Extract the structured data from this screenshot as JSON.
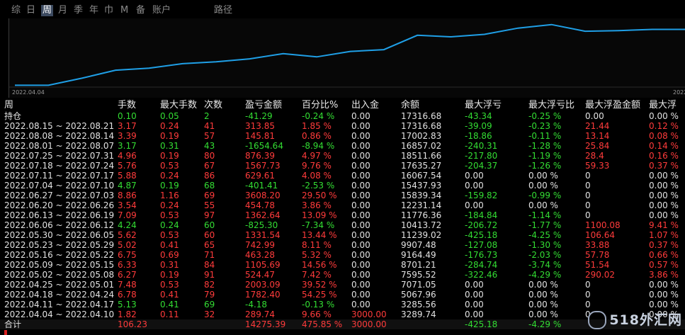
{
  "tabs": [
    "综",
    "日",
    "周",
    "月",
    "季",
    "年",
    "巾",
    "M",
    "备",
    "账户",
    "路径"
  ],
  "active_tab": 2,
  "chart": {
    "start_label": "2022.04.04",
    "end_label": "2022",
    "line_color": "#1f9fe6",
    "balances": [
      3289.74,
      3285.56,
      5067.96,
      7071.05,
      7595.52,
      8701.21,
      9164.49,
      9907.48,
      11239.02,
      10413.72,
      11776.36,
      12231.14,
      15839.34,
      15437.93,
      16067.54,
      17635.27,
      18511.66,
      16857.02,
      17002.83,
      17316.68,
      17316.68
    ]
  },
  "columns": [
    "周",
    "手数",
    "最大手数",
    "次数",
    "盈亏金额",
    "百分比%",
    "出入金",
    "余额",
    "最大浮亏",
    "最大浮亏比",
    "最大浮盈金额",
    "最大浮"
  ],
  "rows": [
    {
      "period": "持仓",
      "lots": "0.10",
      "maxlots": "0.05",
      "count": "2",
      "pnl": "-41.29",
      "pct": "-0.24 %",
      "flow": "0.00",
      "balance": "17316.68",
      "maxdd": "-43.34",
      "maxddpct": "-0.25 %",
      "maxfp": "0.00",
      "maxfppct": "0.00 %",
      "color": "green"
    },
    {
      "period": "2022.08.15 ~ 2022.08.21",
      "lots": "3.17",
      "maxlots": "0.24",
      "count": "41",
      "pnl": "313.85",
      "pct": "1.85 %",
      "flow": "0.00",
      "balance": "17316.68",
      "maxdd": "-39.09",
      "maxddpct": "-0.23 %",
      "maxfp": "21.44",
      "maxfppct": "0.12 %",
      "color": "red"
    },
    {
      "period": "2022.08.08 ~ 2022.08.14",
      "lots": "3.39",
      "maxlots": "0.19",
      "count": "57",
      "pnl": "145.81",
      "pct": "0.86 %",
      "flow": "0.00",
      "balance": "17002.83",
      "maxdd": "-18.86",
      "maxddpct": "-0.11 %",
      "maxfp": "13.14",
      "maxfppct": "0.08 %",
      "color": "red"
    },
    {
      "period": "2022.08.01 ~ 2022.08.07",
      "lots": "3.17",
      "maxlots": "0.31",
      "count": "43",
      "pnl": "-1654.64",
      "pct": "-8.94 %",
      "flow": "0.00",
      "balance": "16857.02",
      "maxdd": "-240.31",
      "maxddpct": "-1.28 %",
      "maxfp": "25.84",
      "maxfppct": "0.14 %",
      "color": "green"
    },
    {
      "period": "2022.07.25 ~ 2022.07.31",
      "lots": "4.96",
      "maxlots": "0.19",
      "count": "80",
      "pnl": "876.39",
      "pct": "4.97 %",
      "flow": "0.00",
      "balance": "18511.66",
      "maxdd": "-217.80",
      "maxddpct": "-1.19 %",
      "maxfp": "28.4",
      "maxfppct": "0.16 %",
      "color": "red"
    },
    {
      "period": "2022.07.18 ~ 2022.07.24",
      "lots": "5.76",
      "maxlots": "0.53",
      "count": "67",
      "pnl": "1567.73",
      "pct": "9.76 %",
      "flow": "0.00",
      "balance": "17635.27",
      "maxdd": "-204.37",
      "maxddpct": "-1.26 %",
      "maxfp": "59.33",
      "maxfppct": "0.37 %",
      "color": "red"
    },
    {
      "period": "2022.07.11 ~ 2022.07.17",
      "lots": "5.88",
      "maxlots": "0.24",
      "count": "86",
      "pnl": "629.61",
      "pct": "4.08 %",
      "flow": "0.00",
      "balance": "16067.54",
      "maxdd": "0.00",
      "maxddpct": "0.00 %",
      "maxfp": "0",
      "maxfppct": "0.00 %",
      "color": "red"
    },
    {
      "period": "2022.07.04 ~ 2022.07.10",
      "lots": "4.87",
      "maxlots": "0.19",
      "count": "68",
      "pnl": "-401.41",
      "pct": "-2.53 %",
      "flow": "0.00",
      "balance": "15437.93",
      "maxdd": "0.00",
      "maxddpct": "0.00 %",
      "maxfp": "0",
      "maxfppct": "0.00 %",
      "color": "green"
    },
    {
      "period": "2022.06.27 ~ 2022.07.03",
      "lots": "8.86",
      "maxlots": "1.16",
      "count": "69",
      "pnl": "3608.20",
      "pct": "29.50 %",
      "flow": "0.00",
      "balance": "15839.34",
      "maxdd": "-159.82",
      "maxddpct": "-0.99 %",
      "maxfp": "0",
      "maxfppct": "0.00 %",
      "color": "red"
    },
    {
      "period": "2022.06.20 ~ 2022.06.26",
      "lots": "3.54",
      "maxlots": "0.24",
      "count": "55",
      "pnl": "454.78",
      "pct": "3.86 %",
      "flow": "0.00",
      "balance": "12231.14",
      "maxdd": "0.00",
      "maxddpct": "0.00 %",
      "maxfp": "0",
      "maxfppct": "0.00 %",
      "color": "red"
    },
    {
      "period": "2022.06.13 ~ 2022.06.19",
      "lots": "7.09",
      "maxlots": "0.53",
      "count": "97",
      "pnl": "1362.64",
      "pct": "13.09 %",
      "flow": "0.00",
      "balance": "11776.36",
      "maxdd": "-184.84",
      "maxddpct": "-1.14 %",
      "maxfp": "0",
      "maxfppct": "0.00 %",
      "color": "red"
    },
    {
      "period": "2022.06.06 ~ 2022.06.12",
      "lots": "4.24",
      "maxlots": "0.24",
      "count": "60",
      "pnl": "-825.30",
      "pct": "-7.34 %",
      "flow": "0.00",
      "balance": "10413.72",
      "maxdd": "-206.72",
      "maxddpct": "-1.77 %",
      "maxfp": "1100.08",
      "maxfppct": "9.41 %",
      "color": "green"
    },
    {
      "period": "2022.05.30 ~ 2022.06.05",
      "lots": "5.62",
      "maxlots": "0.53",
      "count": "60",
      "pnl": "1331.54",
      "pct": "13.44 %",
      "flow": "0.00",
      "balance": "11239.02",
      "maxdd": "-425.18",
      "maxddpct": "-4.25 %",
      "maxfp": "106.64",
      "maxfppct": "1.07 %",
      "color": "red"
    },
    {
      "period": "2022.05.23 ~ 2022.05.29",
      "lots": "5.02",
      "maxlots": "0.41",
      "count": "65",
      "pnl": "742.99",
      "pct": "8.11 %",
      "flow": "0.00",
      "balance": "9907.48",
      "maxdd": "-127.08",
      "maxddpct": "-1.30 %",
      "maxfp": "33.88",
      "maxfppct": "0.37 %",
      "color": "red"
    },
    {
      "period": "2022.05.16 ~ 2022.05.22",
      "lots": "6.75",
      "maxlots": "0.69",
      "count": "71",
      "pnl": "463.28",
      "pct": "5.32 %",
      "flow": "0.00",
      "balance": "9164.49",
      "maxdd": "-176.73",
      "maxddpct": "-2.03 %",
      "maxfp": "57.78",
      "maxfppct": "0.66 %",
      "color": "red"
    },
    {
      "period": "2022.05.09 ~ 2022.05.15",
      "lots": "6.33",
      "maxlots": "0.31",
      "count": "84",
      "pnl": "1105.69",
      "pct": "14.56 %",
      "flow": "0.00",
      "balance": "8701.21",
      "maxdd": "-284.74",
      "maxddpct": "-3.74 %",
      "maxfp": "51.54",
      "maxfppct": "0.57 %",
      "color": "red"
    },
    {
      "period": "2022.05.02 ~ 2022.05.08",
      "lots": "6.27",
      "maxlots": "0.19",
      "count": "91",
      "pnl": "524.47",
      "pct": "7.42 %",
      "flow": "0.00",
      "balance": "7595.52",
      "maxdd": "-322.46",
      "maxddpct": "-4.29 %",
      "maxfp": "290.02",
      "maxfppct": "3.86 %",
      "color": "red"
    },
    {
      "period": "2022.04.25 ~ 2022.05.01",
      "lots": "7.48",
      "maxlots": "0.53",
      "count": "82",
      "pnl": "2003.09",
      "pct": "39.52 %",
      "flow": "0.00",
      "balance": "7071.05",
      "maxdd": "0.00",
      "maxddpct": "0.00 %",
      "maxfp": "0",
      "maxfppct": "0.00 %",
      "color": "red"
    },
    {
      "period": "2022.04.18 ~ 2022.04.24",
      "lots": "6.78",
      "maxlots": "0.41",
      "count": "79",
      "pnl": "1782.40",
      "pct": "54.25 %",
      "flow": "0.00",
      "balance": "5067.96",
      "maxdd": "0.00",
      "maxddpct": "0.00 %",
      "maxfp": "0",
      "maxfppct": "0.00 %",
      "color": "red"
    },
    {
      "period": "2022.04.11 ~ 2022.04.17",
      "lots": "5.13",
      "maxlots": "0.41",
      "count": "69",
      "pnl": "-4.18",
      "pct": "-0.13 %",
      "flow": "0.00",
      "balance": "3285.56",
      "maxdd": "0.00",
      "maxddpct": "0.00 %",
      "maxfp": "0",
      "maxfppct": "0.00 %",
      "color": "green"
    },
    {
      "period": "2022.04.04 ~ 2022.04.10",
      "lots": "1.82",
      "maxlots": "0.11",
      "count": "32",
      "pnl": "289.74",
      "pct": "9.66 %",
      "flow": "3000.00",
      "balance": "3289.74",
      "maxdd": "0.00",
      "maxddpct": "0.00 %",
      "maxfp": "0",
      "maxfppct": "0.00 %",
      "color": "red"
    }
  ],
  "total": {
    "period": "合计",
    "lots": "106.23",
    "pnl": "14275.39",
    "pct": "475.85 %",
    "flow": "3000.00",
    "maxdd": "-425.18",
    "maxddpct": "-4.29 %"
  },
  "watermark": "518外汇网",
  "colors": {
    "positive": "#ff3b3b",
    "negative": "#33dd33",
    "neutral": "#e2e2e2"
  }
}
